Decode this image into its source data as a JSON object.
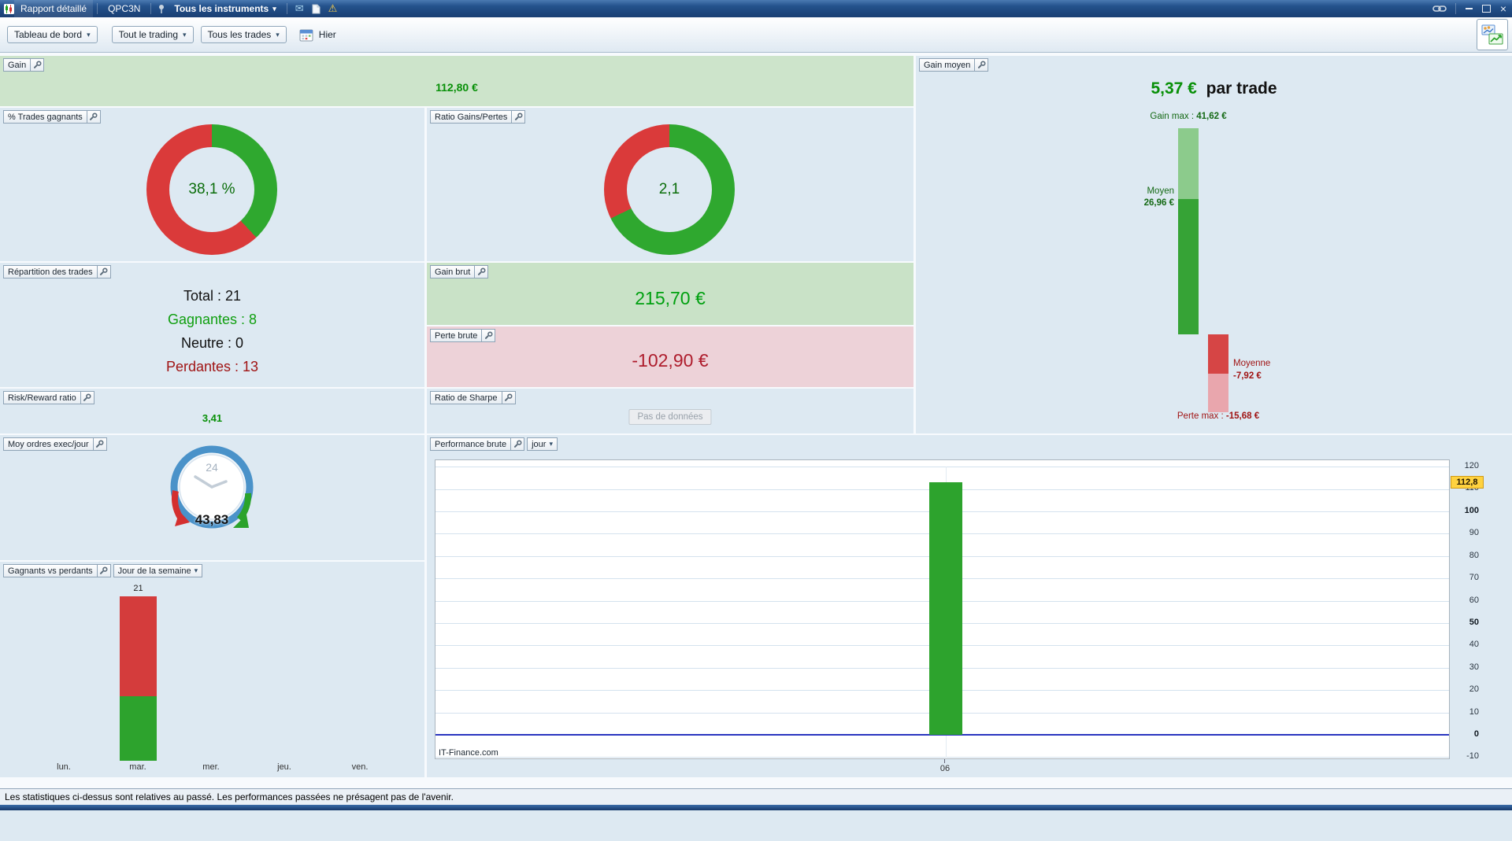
{
  "titlebar": {
    "tab_report": "Rapport détaillé",
    "tab_code": "QPC3N",
    "instruments_dropdown": "Tous les instruments"
  },
  "icons": {
    "dropdown_arrow": "▾",
    "warning": "⚠",
    "envelope": "✉",
    "close": "×"
  },
  "toolbar": {
    "dashboard_dropdown": "Tableau de bord",
    "trading_dropdown": "Tout le trading",
    "trades_dropdown": "Tous les trades",
    "period": "Hier"
  },
  "gain": {
    "title": "Gain",
    "value": "112,80 €"
  },
  "pct_trades": {
    "title": "% Trades gagnants",
    "value": "38,1 %",
    "chart_data": {
      "type": "pie",
      "slices": [
        {
          "label": "Trades gagnants",
          "value": 38.1,
          "color": "#2fa82f"
        },
        {
          "label": "Trades perdants",
          "value": 61.9,
          "color": "#da3a3a"
        }
      ]
    }
  },
  "ratio_gp": {
    "title": "Ratio Gains/Pertes",
    "value": "2,1",
    "chart_data": {
      "type": "pie",
      "slices": [
        {
          "label": "Gains",
          "value": 67.7,
          "color": "#2fa82f"
        },
        {
          "label": "Pertes",
          "value": 32.3,
          "color": "#da3a3a"
        }
      ]
    }
  },
  "repartition": {
    "title": "Répartition des trades",
    "total": "Total : 21",
    "gagnantes": "Gagnantes : 8",
    "neutre": "Neutre : 0",
    "perdantes": "Perdantes : 13"
  },
  "gain_brut": {
    "title": "Gain brut",
    "value": "215,70 €"
  },
  "perte_brute": {
    "title": "Perte brute",
    "value": "-102,90 €"
  },
  "risk_reward": {
    "title": "Risk/Reward ratio",
    "value": "3,41"
  },
  "sharpe": {
    "title": "Ratio de Sharpe",
    "no_data": "Pas de données"
  },
  "gain_moyen": {
    "title": "Gain moyen",
    "headline_value": "5,37 €",
    "headline_suffix": "par trade",
    "gain_max_label": "Gain max :",
    "gain_max_value": "41,62 €",
    "moyen_label": "Moyen",
    "moyen_value": "26,96 €",
    "moyenne_label": "Moyenne",
    "moyenne_value": "-7,92 €",
    "perte_max_label": "Perte max :",
    "perte_max_value": "-15,68 €",
    "chart_data": {
      "type": "bar",
      "unit": "€",
      "series": [
        {
          "name": "Gain max",
          "value": 41.62
        },
        {
          "name": "Gain moyen",
          "value": 26.96
        },
        {
          "name": "Perte moyenne",
          "value": -7.92
        },
        {
          "name": "Perte max",
          "value": -15.68
        }
      ]
    }
  },
  "moy_ordres": {
    "title": "Moy ordres exec/jour",
    "value": "43,83",
    "gauge_label": "24"
  },
  "weekday": {
    "title": "Gagnants vs perdants",
    "dropdown": "Jour de la semaine",
    "bar_label": "21",
    "days": [
      "lun.",
      "mar.",
      "mer.",
      "jeu.",
      "ven."
    ],
    "chart_data": {
      "type": "bar",
      "stacked": true,
      "categories": [
        "lun.",
        "mar.",
        "mer.",
        "jeu.",
        "ven."
      ],
      "series": [
        {
          "name": "Perdants",
          "color": "#d43c3c",
          "values": [
            0,
            13,
            0,
            0,
            0
          ]
        },
        {
          "name": "Gagnants",
          "color": "#2da32d",
          "values": [
            0,
            8,
            0,
            0,
            0
          ]
        }
      ],
      "total_label": 21
    }
  },
  "performance": {
    "title": "Performance brute",
    "dropdown": "jour",
    "watermark": "IT-Finance.com",
    "current_label": "112,8",
    "x_label": "06",
    "yticks": [
      "120",
      "110",
      "100",
      "90",
      "80",
      "70",
      "60",
      "50",
      "40",
      "30",
      "20",
      "10",
      "0",
      "-10"
    ],
    "chart_data": {
      "type": "bar",
      "x": [
        "06"
      ],
      "values": [
        112.8
      ],
      "ylim": [
        -10,
        120
      ],
      "grid": true,
      "bar_color": "#2da32d",
      "zero_line": true,
      "unit": "€"
    }
  },
  "footer": {
    "disclaimer": "Les statistiques ci-dessus sont relatives au passé. Les performances passées ne présagent pas de l'avenir."
  }
}
